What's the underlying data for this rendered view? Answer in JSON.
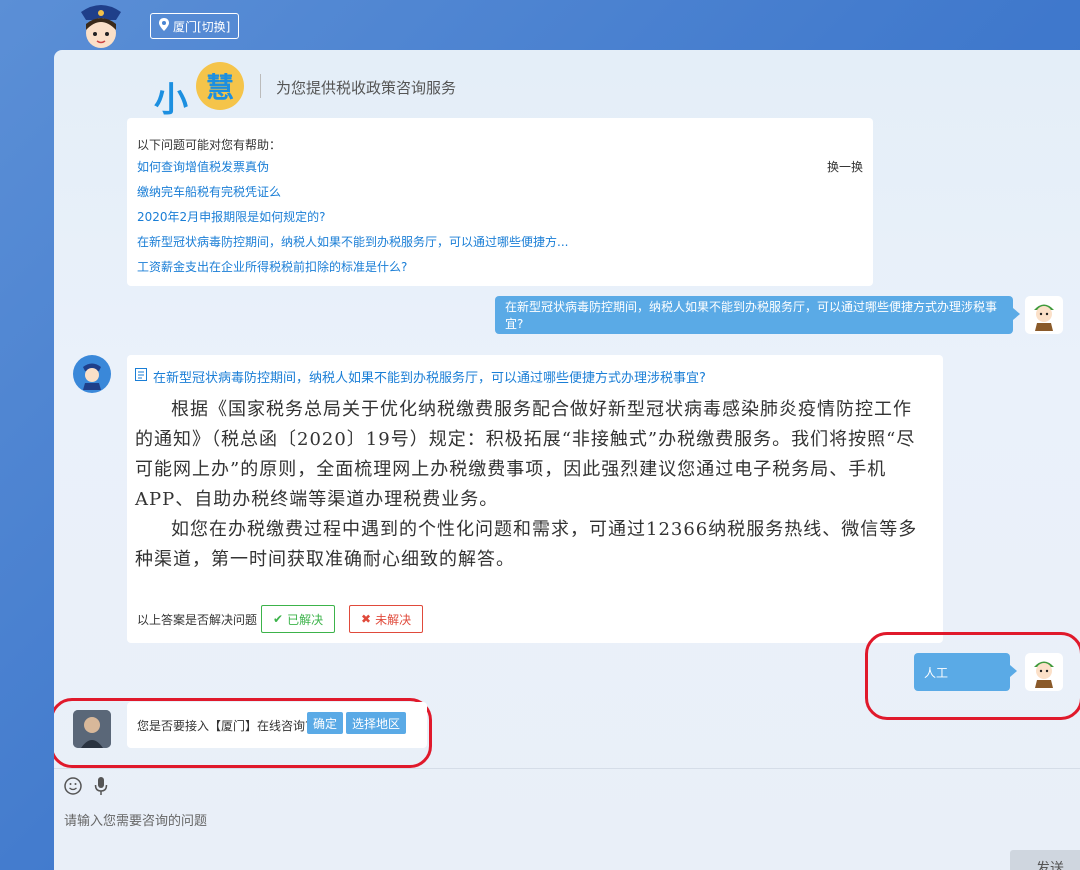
{
  "location": {
    "label": "厦门[切换]"
  },
  "header": {
    "logo_xiao": "小",
    "logo_hui": "慧",
    "slogan": "为您提供税收政策咨询服务"
  },
  "suggestions": {
    "intro": "以下问题可能对您有帮助：",
    "swap": "换一换",
    "items": [
      "如何查询增值税发票真伪",
      "缴纳完车船税有完税凭证么",
      "2020年2月申报期限是如何规定的?",
      "在新型冠状病毒防控期间，纳税人如果不能到办税服务厅，可以通过哪些便捷方...",
      "工资薪金支出在企业所得税税前扣除的标准是什么?"
    ]
  },
  "user_message_1": "在新型冠状病毒防控期间，纳税人如果不能到办税服务厅，可以通过哪些便捷方式办理涉税事宜?",
  "answer": {
    "question": "在新型冠状病毒防控期间，纳税人如果不能到办税服务厅，可以通过哪些便捷方式办理涉税事宜?",
    "paragraph_1": "根据《国家税务总局关于优化纳税缴费服务配合做好新型冠状病毒感染肺炎疫情防控工作的通知》（税总函〔2020〕19号）规定：积极拓展“非接触式”办税缴费服务。我们将按照“尽可能网上办”的原则，全面梳理网上办税缴费事项，因此强烈建议您通过电子税务局、手机APP、自助办税终端等渠道办理税费业务。",
    "paragraph_2": "如您在办税缴费过程中遇到的个性化问题和需求，可通过12366纳税服务热线、微信等多种渠道，第一时间获取准确耐心细致的解答。",
    "feedback_label": "以上答案是否解决问题",
    "resolved": "已解决",
    "unresolved": "未解决"
  },
  "user_message_2": "人工",
  "agent_prompt": {
    "text": "您是否要接入【厦门】在线咨询?",
    "confirm": "确定",
    "choose_region": "选择地区"
  },
  "input": {
    "placeholder": "请输入您需要咨询的问题"
  },
  "send_label": "发送"
}
